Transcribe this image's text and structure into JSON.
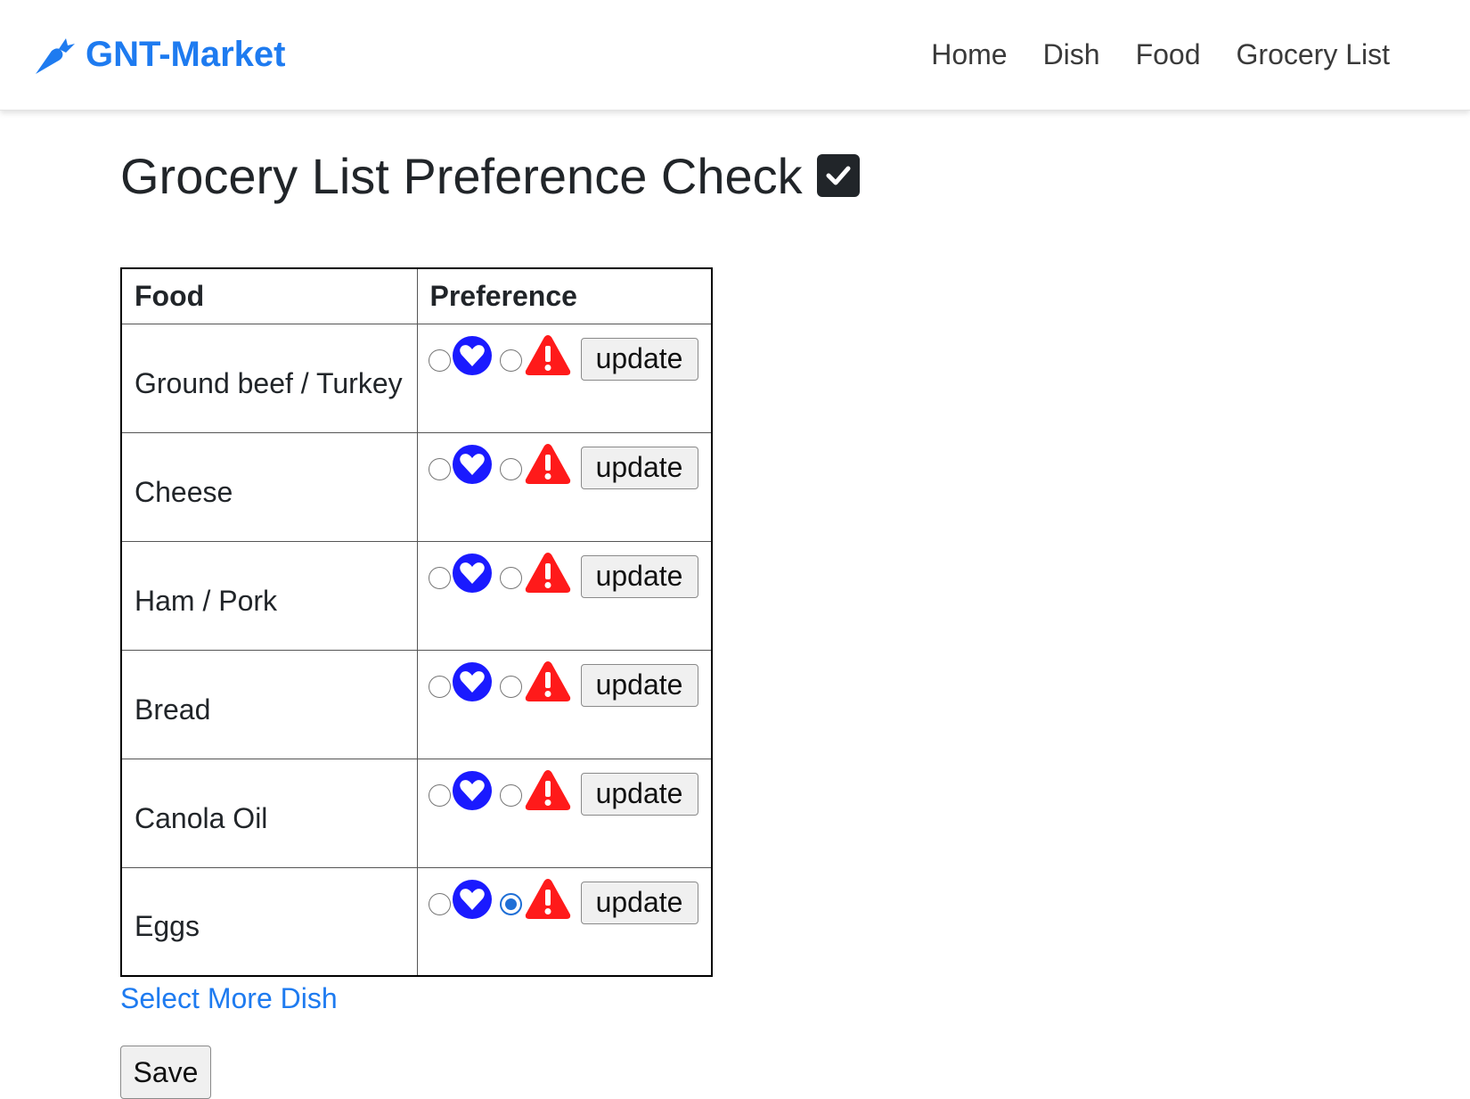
{
  "brand": {
    "name": "GNT-Market",
    "icon": "carrot-icon",
    "color": "#1e7bf0"
  },
  "nav": [
    {
      "label": "Home"
    },
    {
      "label": "Dish"
    },
    {
      "label": "Food"
    },
    {
      "label": "Grocery List"
    }
  ],
  "page": {
    "title": "Grocery List Preference Check",
    "title_icon": "check-square-icon"
  },
  "table": {
    "headers": {
      "food": "Food",
      "preference": "Preference"
    },
    "rows": [
      {
        "food": "Ground beef / Turkey",
        "preference": "none",
        "update_label": "update"
      },
      {
        "food": "Cheese",
        "preference": "none",
        "update_label": "update"
      },
      {
        "food": "Ham / Pork",
        "preference": "none",
        "update_label": "update"
      },
      {
        "food": "Bread",
        "preference": "none",
        "update_label": "update"
      },
      {
        "food": "Canola Oil",
        "preference": "none",
        "update_label": "update"
      },
      {
        "food": "Eggs",
        "preference": "allergy",
        "update_label": "update"
      }
    ],
    "preference_options": [
      {
        "value": "like",
        "icon": "heart-icon",
        "color": "#1a1aff"
      },
      {
        "value": "allergy",
        "icon": "warning-icon",
        "color": "#ff1a1a"
      }
    ]
  },
  "links": {
    "select_more": "Select More Dish"
  },
  "actions": {
    "save_label": "Save"
  }
}
